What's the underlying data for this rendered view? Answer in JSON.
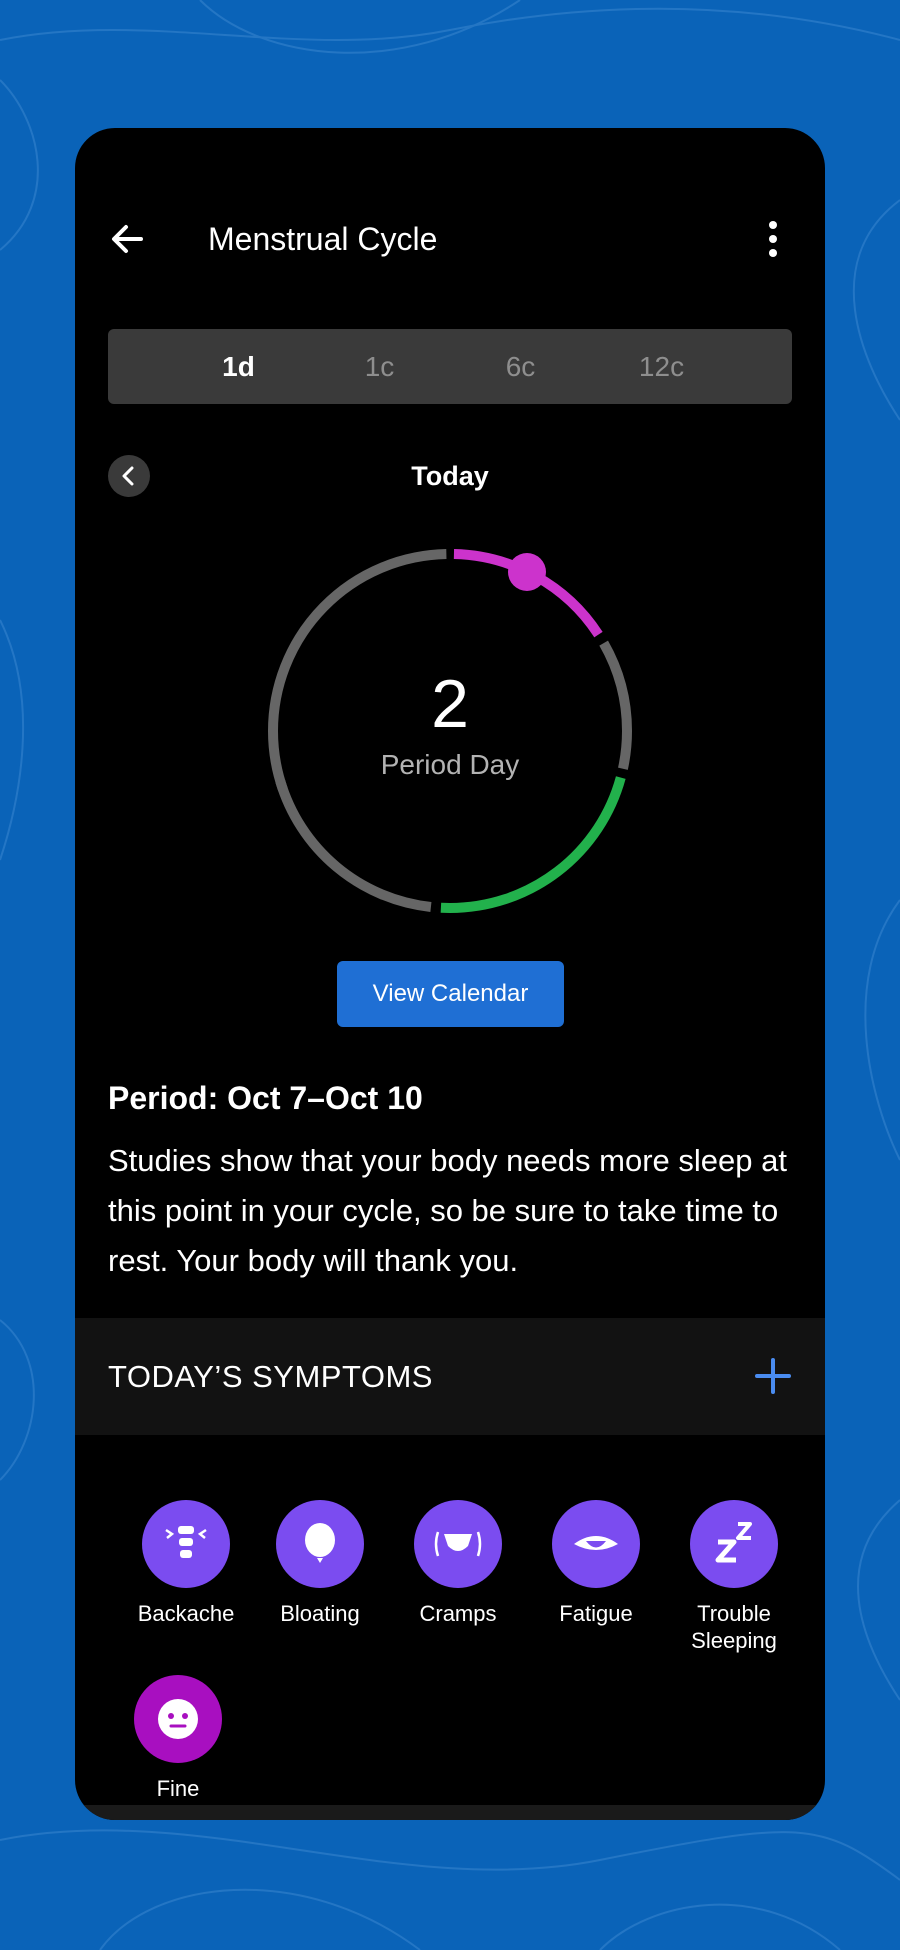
{
  "header": {
    "title": "Menstrual Cycle"
  },
  "range_tabs": [
    {
      "label": "1d",
      "active": true
    },
    {
      "label": "1c",
      "active": false
    },
    {
      "label": "6c",
      "active": false
    },
    {
      "label": "12c",
      "active": false
    }
  ],
  "day_nav": {
    "label": "Today"
  },
  "ring": {
    "day_number": "2",
    "day_label": "Period Day"
  },
  "calendar_button": "View Calendar",
  "period_text": "Period: Oct 7–Oct 10",
  "description": "Studies show that your body needs more sleep at this point in your cycle, so be sure to take time to rest. Your body will thank you.",
  "symptoms": {
    "title": "TODAY’S SYMPTOMS",
    "items": [
      {
        "label": "Backache",
        "icon": "backache-icon"
      },
      {
        "label": "Bloating",
        "icon": "balloon-icon"
      },
      {
        "label": "Cramps",
        "icon": "cramps-icon"
      },
      {
        "label": "Fatigue",
        "icon": "eye-icon"
      },
      {
        "label": "Trouble Sleeping",
        "icon": "zzz-icon"
      },
      {
        "label": "Fine",
        "icon": "neutral-face-icon"
      }
    ]
  },
  "colors": {
    "background": "#0a63b8",
    "period": "#cc33cc",
    "fertile": "#22b14c",
    "track": "#666666",
    "accent": "#1f6fd4",
    "symptom": "#7b4cf0",
    "mood": "#a80fc0"
  }
}
